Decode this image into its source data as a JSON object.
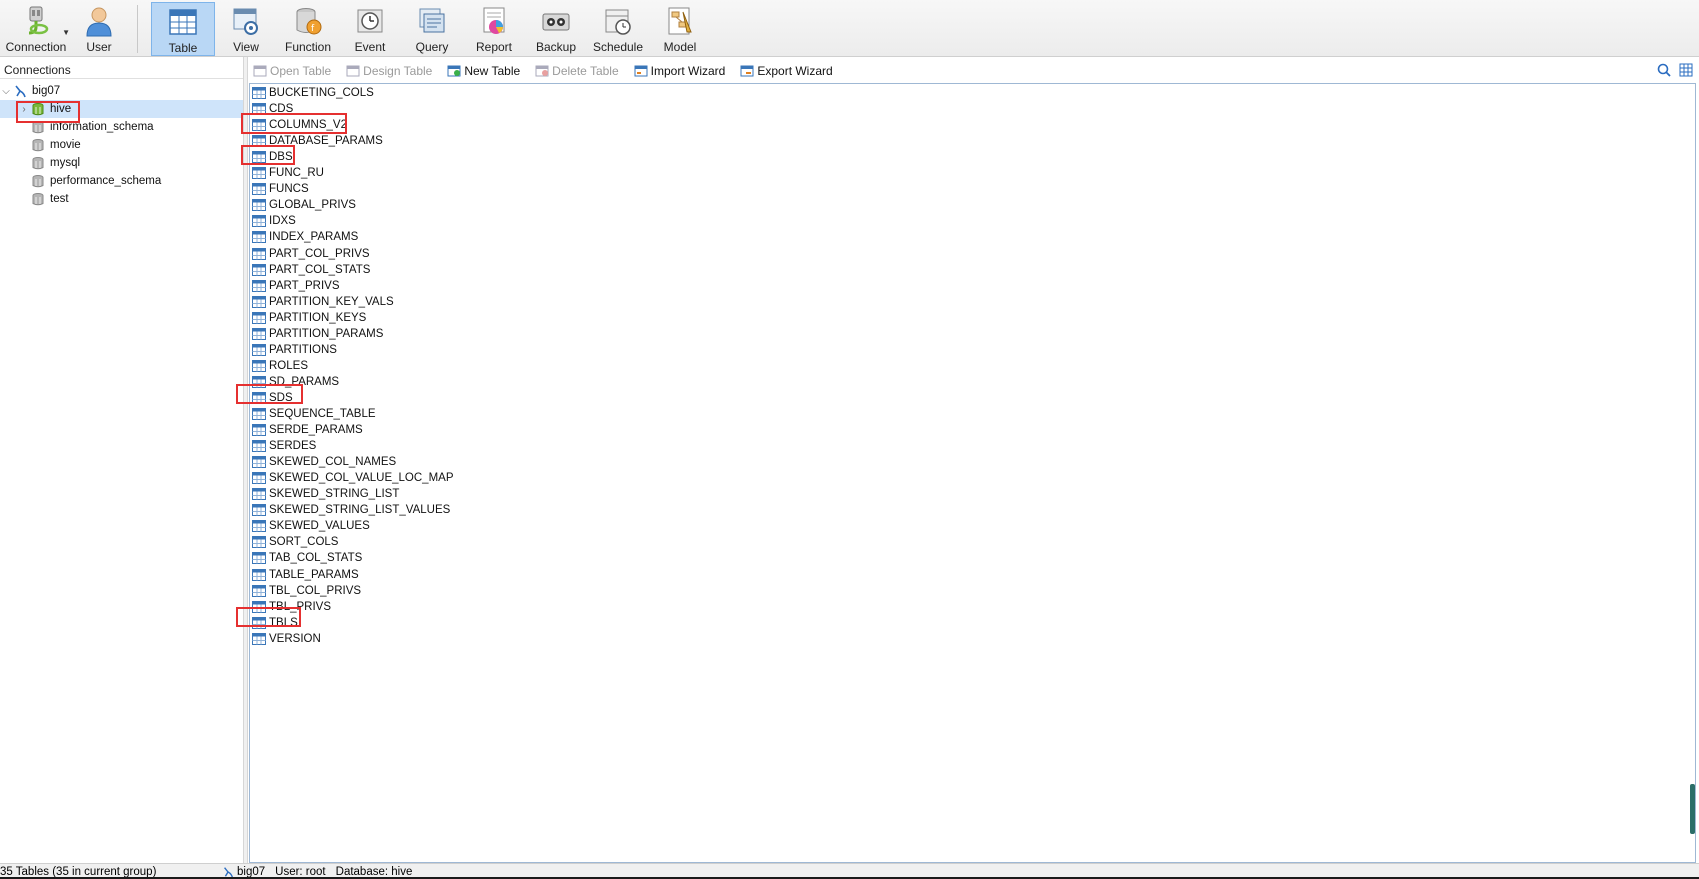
{
  "toolbar": {
    "connection": "Connection",
    "user": "User",
    "table": "Table",
    "view": "View",
    "function": "Function",
    "event": "Event",
    "query": "Query",
    "report": "Report",
    "backup": "Backup",
    "schedule": "Schedule",
    "model": "Model"
  },
  "connections": {
    "header": "Connections",
    "root": "big07",
    "databases": [
      "hive",
      "information_schema",
      "movie",
      "mysql",
      "performance_schema",
      "test"
    ]
  },
  "object_toolbar": {
    "open_table": "Open Table",
    "design_table": "Design Table",
    "new_table": "New Table",
    "delete_table": "Delete Table",
    "import_wizard": "Import Wizard",
    "export_wizard": "Export Wizard"
  },
  "tables": [
    "BUCKETING_COLS",
    "CDS",
    "COLUMNS_V2",
    "DATABASE_PARAMS",
    "DBS",
    "FUNC_RU",
    "FUNCS",
    "GLOBAL_PRIVS",
    "IDXS",
    "INDEX_PARAMS",
    "PART_COL_PRIVS",
    "PART_COL_STATS",
    "PART_PRIVS",
    "PARTITION_KEY_VALS",
    "PARTITION_KEYS",
    "PARTITION_PARAMS",
    "PARTITIONS",
    "ROLES",
    "SD_PARAMS",
    "SDS",
    "SEQUENCE_TABLE",
    "SERDE_PARAMS",
    "SERDES",
    "SKEWED_COL_NAMES",
    "SKEWED_COL_VALUE_LOC_MAP",
    "SKEWED_STRING_LIST",
    "SKEWED_STRING_LIST_VALUES",
    "SKEWED_VALUES",
    "SORT_COLS",
    "TAB_COL_STATS",
    "TABLE_PARAMS",
    "TBL_COL_PRIVS",
    "TBL_PRIVS",
    "TBLS",
    "VERSION"
  ],
  "status": {
    "count": "35 Tables (35 in current group)",
    "connection": "big07",
    "user": "User: root",
    "database": "Database: hive"
  }
}
